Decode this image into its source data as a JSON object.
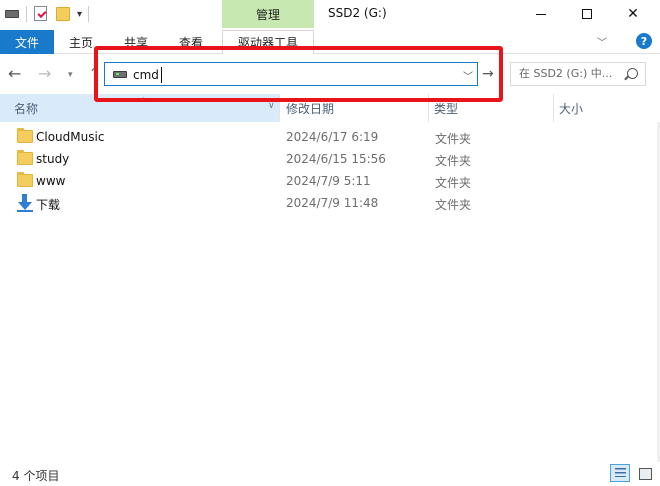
{
  "titlebar": {
    "manage_tab": "管理",
    "title": "SSD2 (G:)"
  },
  "ribbon": {
    "file": "文件",
    "home": "主页",
    "share": "共享",
    "view": "查看",
    "drive_tools": "驱动器工具"
  },
  "address": {
    "value": "cmd",
    "search_placeholder": "在 SSD2 (G:) 中..."
  },
  "columns": {
    "name": "名称",
    "date": "修改日期",
    "type": "类型",
    "size": "大小"
  },
  "files": [
    {
      "name": "CloudMusic",
      "date": "2024/6/17 6:19",
      "type": "文件夹",
      "icon": "folder-icon"
    },
    {
      "name": "study",
      "date": "2024/6/15 15:56",
      "type": "文件夹",
      "icon": "folder-icon"
    },
    {
      "name": "www",
      "date": "2024/7/9 5:11",
      "type": "文件夹",
      "icon": "folder-icon"
    },
    {
      "name": "下载",
      "date": "2024/7/9 11:48",
      "type": "文件夹",
      "icon": "download-icon"
    }
  ],
  "status": {
    "count": "4 个项目"
  },
  "colors": {
    "accent": "#1979ca",
    "highlight": "#e9141a",
    "manage_tab": "#c8e8b2",
    "header_selected": "#d9ebfb"
  }
}
